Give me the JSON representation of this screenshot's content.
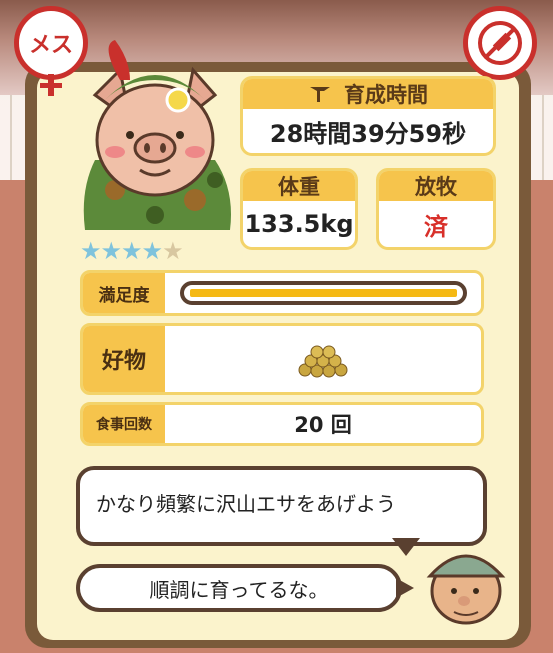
{
  "badges": {
    "gender_label": "メス"
  },
  "stats": {
    "growth_time_label": "育成時間",
    "growth_time_value": "28時間39分59秒",
    "weight_label": "体重",
    "weight_value": "133.5kg",
    "grazing_label": "放牧",
    "grazing_value": "済"
  },
  "rating": {
    "stars_filled": 4,
    "stars_total": 5
  },
  "satisfaction": {
    "label": "満足度",
    "level": 1.0
  },
  "favorite": {
    "label": "好物",
    "icon": "grain-pile-icon"
  },
  "meals": {
    "label": "食事回数",
    "value": "20 回"
  },
  "dialog": {
    "hint": "かなり頻繁に沢山エサをあげよう",
    "comment": "順調に育ってるな。"
  },
  "colors": {
    "accent": "#f6c44c",
    "star": "#7fc3dc",
    "badge_red": "#c9302c",
    "grazing_value": "#d8302a"
  }
}
